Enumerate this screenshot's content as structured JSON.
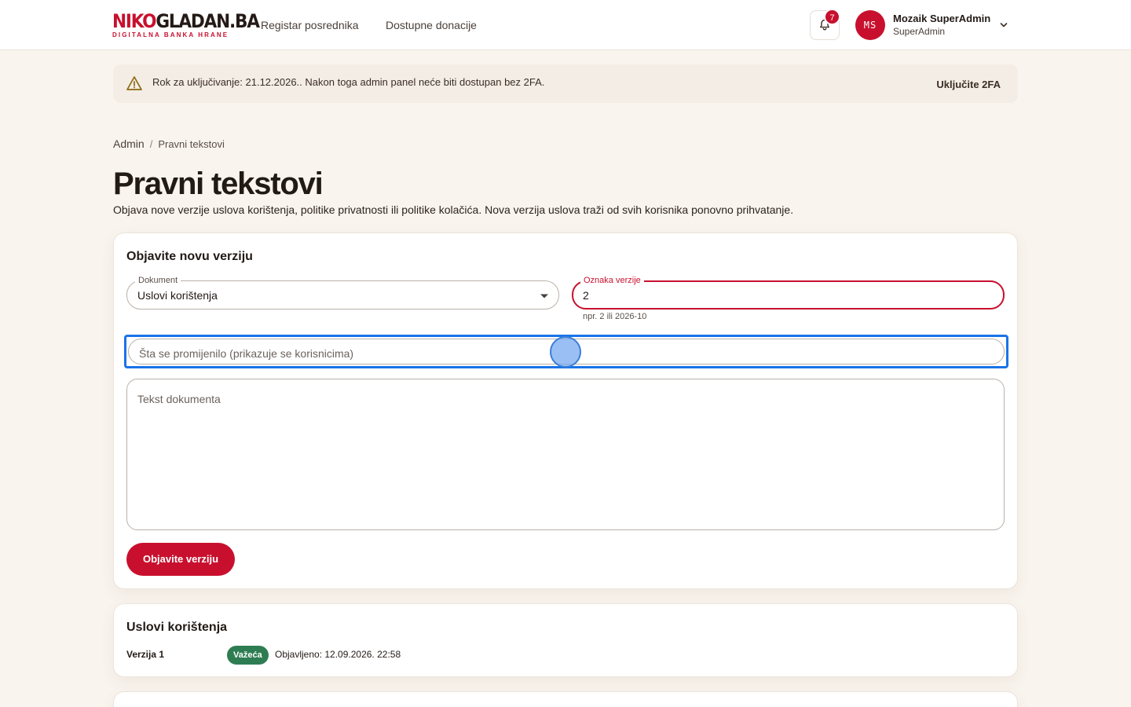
{
  "header": {
    "logo_main_a": "NIKO",
    "logo_main_b": "GLADAN.BA",
    "logo_sub": "DIGITALNA BANKA HRANE",
    "nav": [
      "Registar posrednika",
      "Dostupne donacije"
    ],
    "notifications_count": "7",
    "user": {
      "initials": "MS",
      "name": "Mozaik SuperAdmin",
      "role": "SuperAdmin"
    }
  },
  "alert": {
    "text": "Rok za uključivanje: 21.12.2026.. Nakon toga admin panel neće biti dostupan bez 2FA.",
    "action": "Uključite 2FA"
  },
  "breadcrumb": {
    "root": "Admin",
    "separator": "/",
    "current": "Pravni tekstovi"
  },
  "page": {
    "title": "Pravni tekstovi",
    "description": "Objava nove verzije uslova korištenja, politike privatnosti ili politike kolačića. Nova verzija uslova traži od svih korisnika ponovno prihvatanje."
  },
  "form": {
    "title": "Objavite novu verziju",
    "document_label": "Dokument",
    "document_value": "Uslovi korištenja",
    "version_label": "Oznaka verzije",
    "version_value": "2",
    "version_helper": "npr. 2 ili 2026-10",
    "change_placeholder": "Šta se promijenilo (prikazuje se korisnicima)",
    "text_placeholder": "Tekst dokumenta",
    "submit": "Objavite verziju"
  },
  "terms_card": {
    "title": "Uslovi korištenja",
    "versions": [
      {
        "name": "Verzija 1",
        "badge": "Važeća",
        "published": "Objavljeno: 12.09.2026. 22:58"
      }
    ]
  },
  "colors": {
    "brand": "#c8102e",
    "success": "#2e7d52",
    "focus": "#1a73e8",
    "background": "#f9f4ee"
  }
}
